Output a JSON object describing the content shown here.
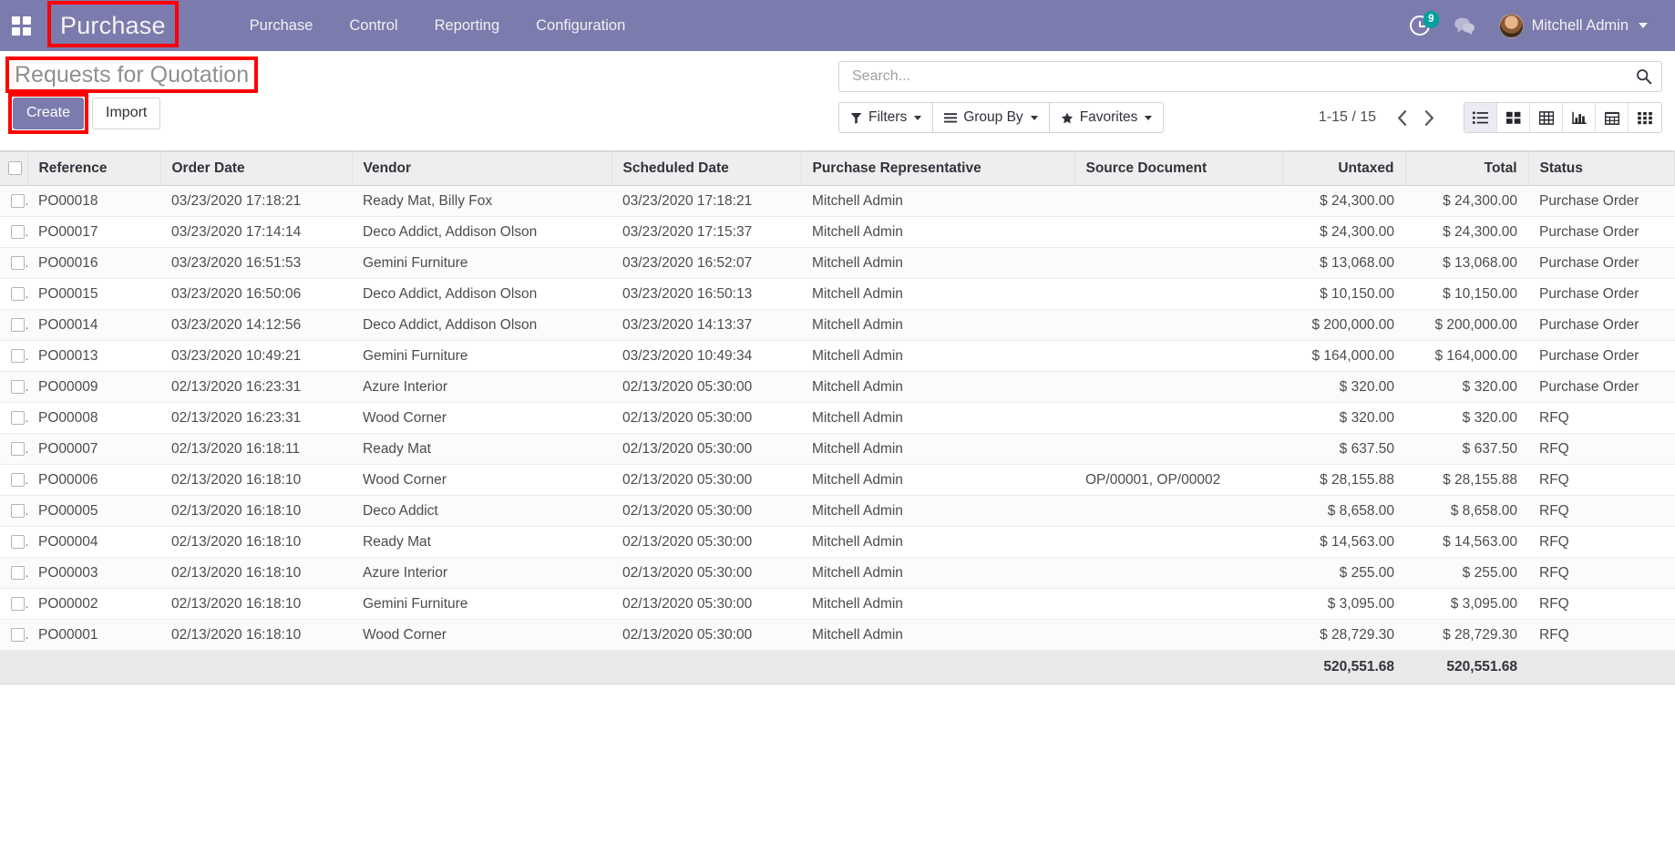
{
  "navbar": {
    "apps_icon": "apps-grid-icon",
    "brand": "Purchase",
    "menu_items": [
      {
        "label": "Purchase"
      },
      {
        "label": "Control"
      },
      {
        "label": "Reporting"
      },
      {
        "label": "Configuration"
      }
    ],
    "activity_icon": "clock-activity-icon",
    "activity_count": "9",
    "messaging_icon": "chat-bubble-icon",
    "avatar_icon": "user-avatar",
    "user_name": "Mitchell Admin",
    "user_caret_icon": "chevron-down-icon",
    "background_color": "#7c7bad"
  },
  "control_panel": {
    "title": "Requests for Quotation",
    "create_label": "Create",
    "import_label": "Import",
    "search": {
      "placeholder": "Search...",
      "value": "",
      "icon": "search-magnifier-icon"
    },
    "filters_label": "Filters",
    "filters_icon": "funnel-icon",
    "group_by_label": "Group By",
    "group_by_icon": "hamburger-lines-icon",
    "favorites_label": "Favorites",
    "favorites_icon": "star-icon",
    "pager": "1-15 / 15",
    "prev_icon": "chevron-left-icon",
    "next_icon": "chevron-right-icon",
    "views": [
      {
        "name": "list-view",
        "icon": "list-icon",
        "active": true
      },
      {
        "name": "kanban-view",
        "icon": "kanban-squares-icon",
        "active": false
      },
      {
        "name": "pivot-view",
        "icon": "pivot-table-icon",
        "active": false
      },
      {
        "name": "graph-view",
        "icon": "bar-chart-icon",
        "active": false
      },
      {
        "name": "calendar-view",
        "icon": "calendar-icon",
        "active": false
      },
      {
        "name": "activity-view",
        "icon": "activity-grid-icon",
        "active": false
      }
    ]
  },
  "highlights": {
    "color": "#fe0000",
    "boxes": [
      "brand-purchase",
      "page-title",
      "create-button"
    ]
  },
  "table": {
    "columns": [
      {
        "key": "reference",
        "label": "Reference",
        "align": "left"
      },
      {
        "key": "order_date",
        "label": "Order Date",
        "align": "left"
      },
      {
        "key": "vendor",
        "label": "Vendor",
        "align": "left"
      },
      {
        "key": "scheduled_date",
        "label": "Scheduled Date",
        "align": "left"
      },
      {
        "key": "purchase_representative",
        "label": "Purchase Representative",
        "align": "left"
      },
      {
        "key": "source_document",
        "label": "Source Document",
        "align": "left"
      },
      {
        "key": "untaxed",
        "label": "Untaxed",
        "align": "right"
      },
      {
        "key": "total",
        "label": "Total",
        "align": "right"
      },
      {
        "key": "status",
        "label": "Status",
        "align": "left"
      }
    ],
    "rows": [
      {
        "reference": "PO00018",
        "order_date": "03/23/2020 17:18:21",
        "vendor": "Ready Mat, Billy Fox",
        "scheduled_date": "03/23/2020 17:18:21",
        "purchase_representative": "Mitchell Admin",
        "source_document": "",
        "untaxed": "$ 24,300.00",
        "total": "$ 24,300.00",
        "status": "Purchase Order"
      },
      {
        "reference": "PO00017",
        "order_date": "03/23/2020 17:14:14",
        "vendor": "Deco Addict, Addison Olson",
        "scheduled_date": "03/23/2020 17:15:37",
        "purchase_representative": "Mitchell Admin",
        "source_document": "",
        "untaxed": "$ 24,300.00",
        "total": "$ 24,300.00",
        "status": "Purchase Order"
      },
      {
        "reference": "PO00016",
        "order_date": "03/23/2020 16:51:53",
        "vendor": "Gemini Furniture",
        "scheduled_date": "03/23/2020 16:52:07",
        "purchase_representative": "Mitchell Admin",
        "source_document": "",
        "untaxed": "$ 13,068.00",
        "total": "$ 13,068.00",
        "status": "Purchase Order"
      },
      {
        "reference": "PO00015",
        "order_date": "03/23/2020 16:50:06",
        "vendor": "Deco Addict, Addison Olson",
        "scheduled_date": "03/23/2020 16:50:13",
        "purchase_representative": "Mitchell Admin",
        "source_document": "",
        "untaxed": "$ 10,150.00",
        "total": "$ 10,150.00",
        "status": "Purchase Order"
      },
      {
        "reference": "PO00014",
        "order_date": "03/23/2020 14:12:56",
        "vendor": "Deco Addict, Addison Olson",
        "scheduled_date": "03/23/2020 14:13:37",
        "purchase_representative": "Mitchell Admin",
        "source_document": "",
        "untaxed": "$ 200,000.00",
        "total": "$ 200,000.00",
        "status": "Purchase Order"
      },
      {
        "reference": "PO00013",
        "order_date": "03/23/2020 10:49:21",
        "vendor": "Gemini Furniture",
        "scheduled_date": "03/23/2020 10:49:34",
        "purchase_representative": "Mitchell Admin",
        "source_document": "",
        "untaxed": "$ 164,000.00",
        "total": "$ 164,000.00",
        "status": "Purchase Order"
      },
      {
        "reference": "PO00009",
        "order_date": "02/13/2020 16:23:31",
        "vendor": "Azure Interior",
        "scheduled_date": "02/13/2020 05:30:00",
        "purchase_representative": "Mitchell Admin",
        "source_document": "",
        "untaxed": "$ 320.00",
        "total": "$ 320.00",
        "status": "Purchase Order"
      },
      {
        "reference": "PO00008",
        "order_date": "02/13/2020 16:23:31",
        "vendor": "Wood Corner",
        "scheduled_date": "02/13/2020 05:30:00",
        "purchase_representative": "Mitchell Admin",
        "source_document": "",
        "untaxed": "$ 320.00",
        "total": "$ 320.00",
        "status": "RFQ"
      },
      {
        "reference": "PO00007",
        "order_date": "02/13/2020 16:18:11",
        "vendor": "Ready Mat",
        "scheduled_date": "02/13/2020 05:30:00",
        "purchase_representative": "Mitchell Admin",
        "source_document": "",
        "untaxed": "$ 637.50",
        "total": "$ 637.50",
        "status": "RFQ"
      },
      {
        "reference": "PO00006",
        "order_date": "02/13/2020 16:18:10",
        "vendor": "Wood Corner",
        "scheduled_date": "02/13/2020 05:30:00",
        "purchase_representative": "Mitchell Admin",
        "source_document": "OP/00001, OP/00002",
        "untaxed": "$ 28,155.88",
        "total": "$ 28,155.88",
        "status": "RFQ"
      },
      {
        "reference": "PO00005",
        "order_date": "02/13/2020 16:18:10",
        "vendor": "Deco Addict",
        "scheduled_date": "02/13/2020 05:30:00",
        "purchase_representative": "Mitchell Admin",
        "source_document": "",
        "untaxed": "$ 8,658.00",
        "total": "$ 8,658.00",
        "status": "RFQ"
      },
      {
        "reference": "PO00004",
        "order_date": "02/13/2020 16:18:10",
        "vendor": "Ready Mat",
        "scheduled_date": "02/13/2020 05:30:00",
        "purchase_representative": "Mitchell Admin",
        "source_document": "",
        "untaxed": "$ 14,563.00",
        "total": "$ 14,563.00",
        "status": "RFQ"
      },
      {
        "reference": "PO00003",
        "order_date": "02/13/2020 16:18:10",
        "vendor": "Azure Interior",
        "scheduled_date": "02/13/2020 05:30:00",
        "purchase_representative": "Mitchell Admin",
        "source_document": "",
        "untaxed": "$ 255.00",
        "total": "$ 255.00",
        "status": "RFQ"
      },
      {
        "reference": "PO00002",
        "order_date": "02/13/2020 16:18:10",
        "vendor": "Gemini Furniture",
        "scheduled_date": "02/13/2020 05:30:00",
        "purchase_representative": "Mitchell Admin",
        "source_document": "",
        "untaxed": "$ 3,095.00",
        "total": "$ 3,095.00",
        "status": "RFQ"
      },
      {
        "reference": "PO00001",
        "order_date": "02/13/2020 16:18:10",
        "vendor": "Wood Corner",
        "scheduled_date": "02/13/2020 05:30:00",
        "purchase_representative": "Mitchell Admin",
        "source_document": "",
        "untaxed": "$ 28,729.30",
        "total": "$ 28,729.30",
        "status": "RFQ"
      }
    ],
    "footer": {
      "untaxed_total": "520,551.68",
      "total_total": "520,551.68"
    }
  }
}
